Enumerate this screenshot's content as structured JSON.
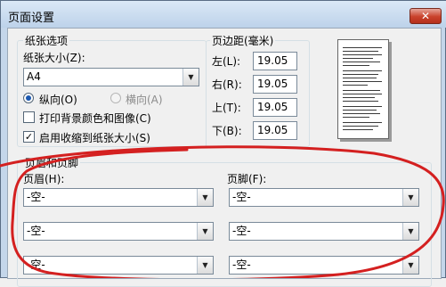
{
  "window": {
    "title": "页面设置",
    "close_glyph": "✕"
  },
  "paper_options": {
    "legend": "纸张选项",
    "size_label": "纸张大小(Z):",
    "size_value": "A4",
    "orientation": {
      "portrait_label": "纵向(O)",
      "landscape_label": "横向(A)",
      "selected": "portrait"
    },
    "print_background_label": "打印背景颜色和图像(C)",
    "print_background_checked": false,
    "shrink_to_fit_label": "启用收缩到纸张大小(S)",
    "shrink_to_fit_checked": true,
    "check_glyph": "✓"
  },
  "margins": {
    "legend": "页边距(毫米)",
    "left_label": "左(L):",
    "left_value": "19.05",
    "right_label": "右(R):",
    "right_value": "19.05",
    "top_label": "上(T):",
    "top_value": "19.05",
    "bottom_label": "下(B):",
    "bottom_value": "19.05"
  },
  "header_footer": {
    "legend": "页眉和页脚",
    "header_label": "页眉(H):",
    "footer_label": "页脚(F):",
    "header_values": [
      "-空-",
      "-空-",
      "-空-"
    ],
    "footer_values": [
      "-空-",
      "-空-",
      "-空-"
    ]
  },
  "dropdown_arrow": "▼",
  "annotation_color": "#d42020"
}
